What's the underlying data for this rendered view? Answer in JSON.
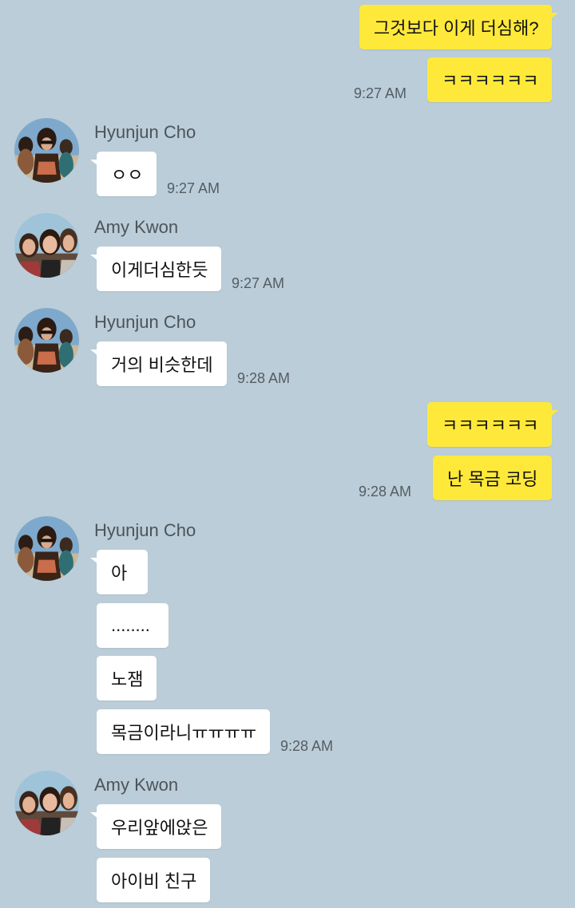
{
  "contacts": {
    "hyunjun": "Hyunjun Cho",
    "amy": "Amy Kwon"
  },
  "messages": {
    "m1": {
      "text": "그것보다 이게 더심해?"
    },
    "m2": {
      "text": "ㅋㅋㅋㅋㅋㅋ",
      "time": "9:27 AM"
    },
    "m3": {
      "text": "ㅇㅇ",
      "time": "9:27 AM"
    },
    "m4": {
      "text": "이게더심한듯",
      "time": "9:27 AM"
    },
    "m5": {
      "text": "거의 비슷한데",
      "time": "9:28 AM"
    },
    "m6": {
      "text": "ㅋㅋㅋㅋㅋㅋ"
    },
    "m7": {
      "text": "난 목금 코딩",
      "time": "9:28 AM"
    },
    "m8": {
      "text": "아"
    },
    "m9": {
      "text": "........"
    },
    "m10": {
      "text": "노잼"
    },
    "m11": {
      "text": "목금이라니ㅠㅠㅠㅠ",
      "time": "9:28 AM"
    },
    "m12": {
      "text": "우리앞에앉은"
    },
    "m13": {
      "text": "아이비 친구"
    }
  },
  "colors": {
    "background": "#bacdd8",
    "my_bubble": "#fee93a",
    "their_bubble": "#ffffff",
    "timestamp": "#555d63",
    "sender_name": "#4d5459"
  },
  "icons": {
    "hyunjun_avatar": "profile-photo-beach-group",
    "amy_avatar": "profile-photo-selfie-group"
  }
}
